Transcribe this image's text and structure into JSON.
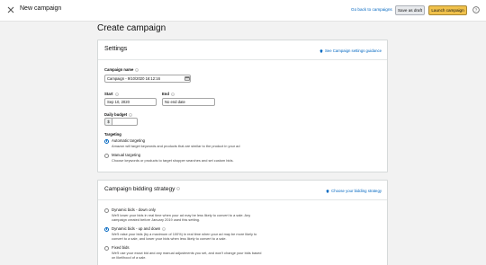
{
  "header": {
    "title": "New campaign",
    "back_link": "Go back to campaigns",
    "save_draft": "Save as draft",
    "launch": "Launch campaign"
  },
  "page_title": "Create campaign",
  "settings": {
    "title": "Settings",
    "guidance_link": "See Campaign settings guidance",
    "campaign_name_label": "Campaign name",
    "campaign_name_value": "Campaign - 9/10/2020 16:12:16",
    "start_label": "Start",
    "start_value": "Sep 10, 2020",
    "end_label": "End",
    "end_value": "No end date",
    "budget_label": "Daily budget",
    "currency": "$",
    "budget_value": "",
    "targeting_label": "Targeting",
    "targeting_options": [
      {
        "title": "Automatic targeting",
        "desc": "Amazon will target keywords and products that are similar to the product in your ad",
        "selected": true
      },
      {
        "title": "Manual targeting",
        "desc": "Choose keywords or products to target shopper searches and set custom bids.",
        "selected": false
      }
    ]
  },
  "bidding": {
    "title": "Campaign bidding strategy",
    "choose_link": "Choose your bidding strategy",
    "options": [
      {
        "title": "Dynamic bids - down only",
        "desc1": "We'll lower your bids in real time when your ad may be less likely to convert to a sale. Any",
        "desc2": "campaign created before January 2019 used this setting.",
        "selected": false
      },
      {
        "title": "Dynamic bids - up and down",
        "desc1": "We'll raise your bids (by a maximum of 100%) in real time when your ad may be more likely to",
        "desc2": "convert to a sale, and lower your bids when less likely to convert to a sale.",
        "selected": true
      },
      {
        "title": "Fixed bids",
        "desc1": "We'll use your exact bid and any manual adjustments you set, and won't change your bids based",
        "desc2": "on likelihood of a sale.",
        "selected": false
      }
    ]
  },
  "colors": {
    "link": "#0066c0",
    "launch_button": "#f0c14b",
    "background": "#f2f2f2"
  },
  "icons": [
    "close-icon",
    "help-icon",
    "lightbulb-icon",
    "info-icon",
    "calendar-icon"
  ]
}
